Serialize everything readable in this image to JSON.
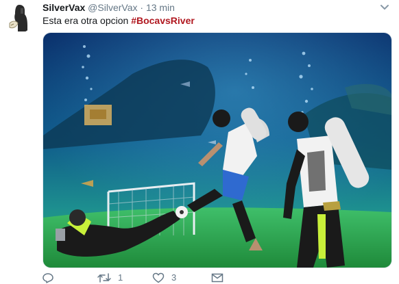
{
  "tweet": {
    "display_name": "SilverVax",
    "handle": "@SilverVax",
    "separator": "·",
    "time": "13 min",
    "text": "Esta era otra opcion ",
    "hashtag": "#BocavsRiver",
    "hashtag_color": "#b0171f"
  },
  "actions": {
    "reply_count": "",
    "retweet_count": "1",
    "like_count": "3"
  },
  "icons": {
    "menu": "chevron-down-icon",
    "reply": "reply-icon",
    "retweet": "retweet-icon",
    "like": "heart-icon",
    "dm": "envelope-icon"
  }
}
